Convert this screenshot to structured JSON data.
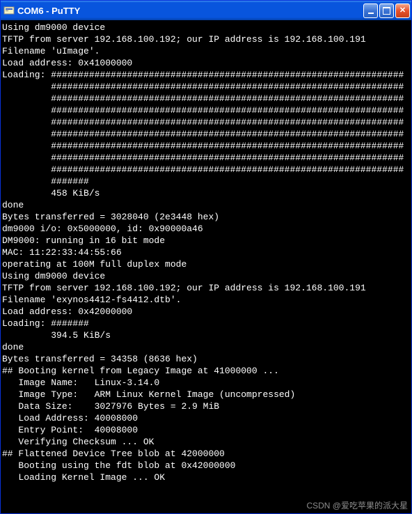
{
  "window": {
    "title": "COM6 - PuTTY"
  },
  "terminal": {
    "lines": [
      "Using dm9000 device",
      "TFTP from server 192.168.100.192; our IP address is 192.168.100.191",
      "Filename 'uImage'.",
      "Load address: 0x41000000",
      "Loading: #################################################################",
      "         #################################################################",
      "         #################################################################",
      "         #################################################################",
      "         #################################################################",
      "         #################################################################",
      "         #################################################################",
      "         #################################################################",
      "         #################################################################",
      "         #######",
      "         458 KiB/s",
      "done",
      "Bytes transferred = 3028040 (2e3448 hex)",
      "dm9000 i/o: 0x5000000, id: 0x90000a46",
      "DM9000: running in 16 bit mode",
      "MAC: 11:22:33:44:55:66",
      "operating at 100M full duplex mode",
      "Using dm9000 device",
      "TFTP from server 192.168.100.192; our IP address is 192.168.100.191",
      "Filename 'exynos4412-fs4412.dtb'.",
      "Load address: 0x42000000",
      "Loading: #######",
      "         394.5 KiB/s",
      "done",
      "Bytes transferred = 34358 (8636 hex)",
      "## Booting kernel from Legacy Image at 41000000 ...",
      "   Image Name:   Linux-3.14.0",
      "   Image Type:   ARM Linux Kernel Image (uncompressed)",
      "   Data Size:    3027976 Bytes = 2.9 MiB",
      "   Load Address: 40008000",
      "   Entry Point:  40008000",
      "   Verifying Checksum ... OK",
      "## Flattened Device Tree blob at 42000000",
      "   Booting using the fdt blob at 0x42000000",
      "   Loading Kernel Image ... OK"
    ]
  },
  "watermark": "CSDN @爱吃苹果的派大星"
}
